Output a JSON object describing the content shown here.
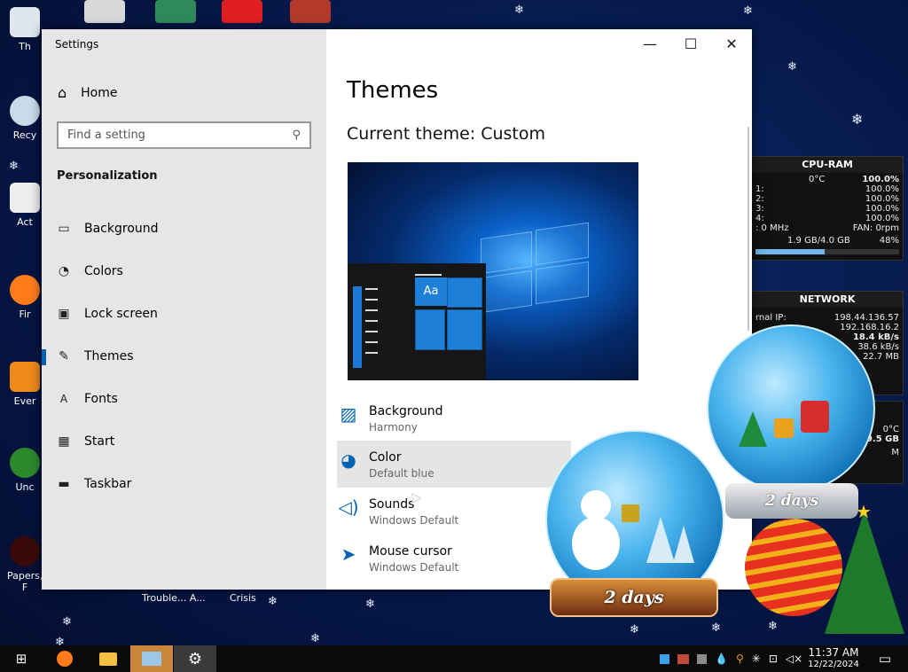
{
  "settings": {
    "title": "Settings",
    "home_label": "Home",
    "search_placeholder": "Find a setting",
    "section": "Personalization",
    "nav": [
      {
        "label": "Background",
        "icon": "image-icon"
      },
      {
        "label": "Colors",
        "icon": "palette-icon"
      },
      {
        "label": "Lock screen",
        "icon": "lock-screen-icon"
      },
      {
        "label": "Themes",
        "icon": "brush-icon"
      },
      {
        "label": "Fonts",
        "icon": "fonts-icon"
      },
      {
        "label": "Start",
        "icon": "start-icon"
      },
      {
        "label": "Taskbar",
        "icon": "taskbar-icon"
      }
    ],
    "active_nav": "Themes",
    "page_title": "Themes",
    "current_theme": "Current theme: Custom",
    "preview_tile_text": "Aa",
    "theme_settings": [
      {
        "title": "Background",
        "subtitle": "Harmony",
        "icon": "picture-icon"
      },
      {
        "title": "Color",
        "subtitle": "Default blue",
        "icon": "palette-icon"
      },
      {
        "title": "Sounds",
        "subtitle": "Windows Default",
        "icon": "speaker-icon"
      },
      {
        "title": "Mouse cursor",
        "subtitle": "Windows Default",
        "icon": "cursor-icon"
      }
    ],
    "accent": "#0063b1"
  },
  "desktop": {
    "icon_labels": [
      "Th",
      "Recy",
      "Act",
      "Fir",
      "Ever",
      "Unc",
      "Papers, F"
    ],
    "bottom_labels": [
      "Trouble... A...",
      "Crisis"
    ],
    "globe_label": "2 days"
  },
  "widgets": {
    "cpu": {
      "title": "CPU-RAM",
      "temp": "0°C",
      "total": "100.0%",
      "cores": [
        {
          "label": "1:",
          "value": "100.0%"
        },
        {
          "label": "2:",
          "value": "100.0%"
        },
        {
          "label": "3:",
          "value": "100.0%"
        },
        {
          "label": "4:",
          "value": "100.0%"
        }
      ],
      "clock": ": 0 MHz",
      "fan": "FAN: 0rpm",
      "ram": "1.9 GB/4.0 GB",
      "ram_pct": "48%"
    },
    "network": {
      "title": "NETWORK",
      "external_label": "rnal IP:",
      "external_ip": "198.44.136.57",
      "internal_ip": "192.168.16.2",
      "upload": "18.4 kB/s",
      "download": "38.6 kB/s",
      "total": "22.7 MB"
    },
    "third": {
      "temp": "0°C",
      "size": "9.5 GB",
      "marker": "M"
    }
  },
  "taskbar": {
    "time": "11:37 AM",
    "date": "12/22/2024"
  }
}
